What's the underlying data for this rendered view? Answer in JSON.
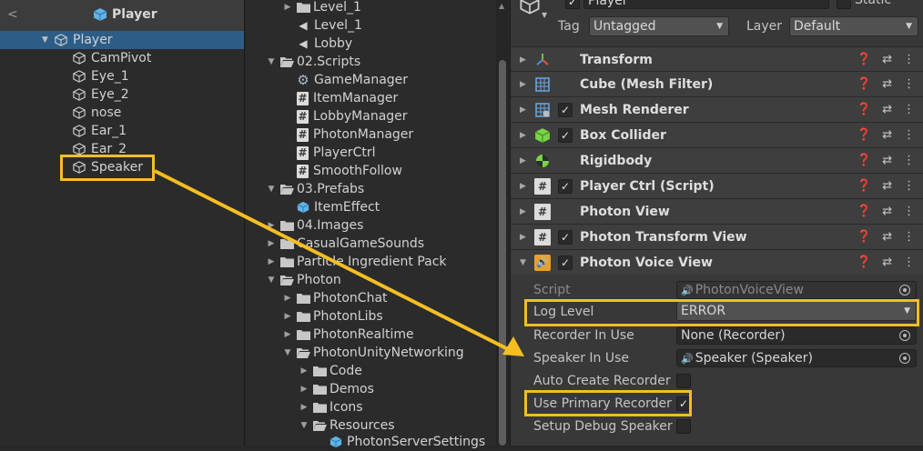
{
  "hierarchy": {
    "back_glyph": "<",
    "title": "Player",
    "root": "Player",
    "children": [
      "CamPivot",
      "Eye_1",
      "Eye_2",
      "nose",
      "Ear_1",
      "Ear_2",
      "Speaker"
    ]
  },
  "project": {
    "items": [
      {
        "label": "Level_1",
        "kind": "folder"
      },
      {
        "label": "Level_1",
        "kind": "scene"
      },
      {
        "label": "Lobby",
        "kind": "scene"
      },
      {
        "label": "02.Scripts",
        "kind": "folder-open"
      },
      {
        "label": "GameManager",
        "kind": "gear"
      },
      {
        "label": "ItemManager",
        "kind": "script"
      },
      {
        "label": "LobbyManager",
        "kind": "script"
      },
      {
        "label": "PhotonManager",
        "kind": "script"
      },
      {
        "label": "PlayerCtrl",
        "kind": "script"
      },
      {
        "label": "SmoothFollow",
        "kind": "script"
      },
      {
        "label": "03.Prefabs",
        "kind": "folder-open"
      },
      {
        "label": "ItemEffect",
        "kind": "prefab"
      },
      {
        "label": "04.Images",
        "kind": "folder"
      },
      {
        "label": "CasualGameSounds",
        "kind": "folder"
      },
      {
        "label": "Particle Ingredient Pack",
        "kind": "folder"
      },
      {
        "label": "Photon",
        "kind": "folder-open"
      },
      {
        "label": "PhotonChat",
        "kind": "folder"
      },
      {
        "label": "PhotonLibs",
        "kind": "folder"
      },
      {
        "label": "PhotonRealtime",
        "kind": "folder"
      },
      {
        "label": "PhotonUnityNetworking",
        "kind": "folder-open"
      },
      {
        "label": "Code",
        "kind": "folder"
      },
      {
        "label": "Demos",
        "kind": "folder"
      },
      {
        "label": "Icons",
        "kind": "folder"
      },
      {
        "label": "Resources",
        "kind": "folder-open"
      },
      {
        "label": "PhotonServerSettings",
        "kind": "prefab"
      }
    ]
  },
  "inspector": {
    "object_name": "Player",
    "static_label": "Static",
    "tag_label": "Tag",
    "tag_value": "Untagged",
    "layer_label": "Layer",
    "layer_value": "Default",
    "components": [
      {
        "name": "Transform",
        "checkbox": false,
        "icon": "transform-icon"
      },
      {
        "name": "Cube (Mesh Filter)",
        "checkbox": false,
        "icon": "mesh-filter-icon"
      },
      {
        "name": "Mesh Renderer",
        "checkbox": true,
        "icon": "mesh-renderer-icon"
      },
      {
        "name": "Box Collider",
        "checkbox": true,
        "icon": "box-collider-icon"
      },
      {
        "name": "Rigidbody",
        "checkbox": false,
        "icon": "rigidbody-icon"
      },
      {
        "name": "Player Ctrl (Script)",
        "checkbox": true,
        "icon": "script-icon"
      },
      {
        "name": "Photon View",
        "checkbox": false,
        "icon": "script-icon"
      },
      {
        "name": "Photon Transform View",
        "checkbox": true,
        "icon": "script-icon"
      },
      {
        "name": "Photon Voice View",
        "checkbox": true,
        "icon": "speaker-icon"
      }
    ],
    "voice_props": {
      "script_label": "Script",
      "script_value": "PhotonVoiceView",
      "log_level_label": "Log Level",
      "log_level_value": "ERROR",
      "recorder_label": "Recorder In Use",
      "recorder_value": "None (Recorder)",
      "speaker_label": "Speaker In Use",
      "speaker_value": "Speaker (Speaker)",
      "auto_create_label": "Auto Create Recorder",
      "use_primary_label": "Use Primary Recorder",
      "setup_debug_label": "Setup Debug Speaker"
    }
  },
  "colors": {
    "highlight": "#f5be23",
    "selection": "#2c5d87"
  }
}
